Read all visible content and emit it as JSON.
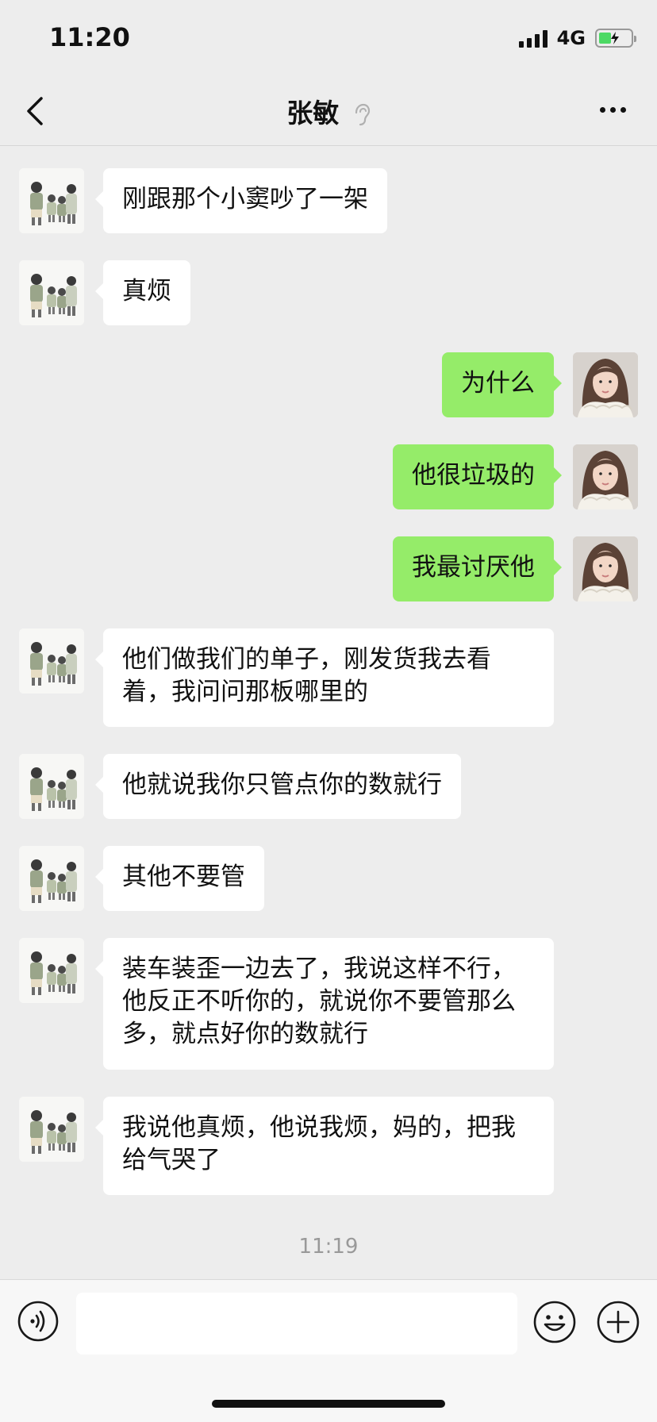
{
  "status": {
    "time": "11:20",
    "network": "4G"
  },
  "header": {
    "title": "张敏"
  },
  "messages": [
    {
      "side": "left",
      "text": "刚跟那个小窦吵了一架"
    },
    {
      "side": "left",
      "text": "真烦"
    },
    {
      "side": "right",
      "text": "为什么"
    },
    {
      "side": "right",
      "text": "他很垃圾的"
    },
    {
      "side": "right",
      "text": "我最讨厌他"
    },
    {
      "side": "left",
      "text": "他们做我们的单子，刚发货我去看着，我问问那板哪里的"
    },
    {
      "side": "left",
      "text": "他就说我你只管点你的数就行"
    },
    {
      "side": "left",
      "text": "其他不要管"
    },
    {
      "side": "left",
      "text": "装车装歪一边去了，我说这样不行，他反正不听你的，就说你不要管那么多，就点好你的数就行"
    },
    {
      "side": "left",
      "text": "我说他真烦，他说我烦，妈的，把我给气哭了"
    }
  ],
  "timestamp": "11:19",
  "input": {
    "value": "",
    "placeholder": ""
  },
  "colors": {
    "background": "#ededed",
    "own_bubble": "#95ec69",
    "other_bubble": "#ffffff",
    "battery": "#4cd964"
  },
  "icons": {
    "back": "chevron-left-icon",
    "mute": "ear-icon",
    "more": "more-dots-icon",
    "voice": "voice-icon",
    "emoji": "emoji-icon",
    "add": "plus-icon"
  }
}
